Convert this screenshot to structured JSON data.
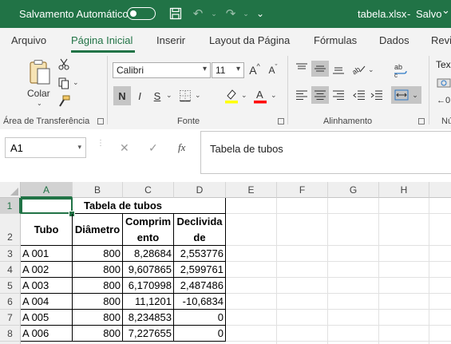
{
  "titlebar": {
    "autosave_label": "Salvamento Automático",
    "filename": "tabela.xlsx",
    "separator": "-",
    "save_status": "Salvo",
    "save_status_dropdown": "⌄"
  },
  "tabs": [
    "Arquivo",
    "Página Inicial",
    "Inserir",
    "Layout da Página",
    "Fórmulas",
    "Dados",
    "Revi"
  ],
  "ribbon": {
    "clipboard": {
      "paste_label": "Colar",
      "group_label": "Área de Transferência"
    },
    "font": {
      "font_name": "Calibri",
      "font_size": "11",
      "grow": "A",
      "shrink": "A",
      "bold": "N",
      "italic": "I",
      "underline": "S",
      "group_label": "Fonte",
      "font_color": "#ff0000",
      "highlight_color": "#ffff00"
    },
    "alignment": {
      "group_label": "Alinhamento"
    },
    "number": {
      "format_partial": "Tex",
      "group_label": "Nú"
    }
  },
  "formula_bar": {
    "name_box": "A1",
    "cancel": "✕",
    "enter": "✓",
    "fx": "fx",
    "content": "Tabela de tubos"
  },
  "sheet": {
    "columns": [
      "A",
      "B",
      "C",
      "D",
      "E",
      "F",
      "G",
      "H"
    ],
    "rows": [
      "1",
      "2",
      "3",
      "4",
      "5",
      "6",
      "7",
      "8"
    ],
    "title": "Tabela de tubos",
    "headers": {
      "tubo": "Tubo",
      "diametro": "Diâmetro",
      "comprimento_1": "Comprim",
      "comprimento_2": "ento",
      "declividade_1": "Declivida",
      "declividade_2": "de"
    },
    "data": [
      [
        "A 001",
        "800",
        "8,28684",
        "2,553776"
      ],
      [
        "A 002",
        "800",
        "9,607865",
        "2,599761"
      ],
      [
        "A 003",
        "800",
        "6,170998",
        "2,487486"
      ],
      [
        "A 004",
        "800",
        "11,1201",
        "-10,6834"
      ],
      [
        "A 005",
        "800",
        "8,234853",
        "0"
      ],
      [
        "A 006",
        "800",
        "7,227655",
        "0"
      ]
    ]
  }
}
